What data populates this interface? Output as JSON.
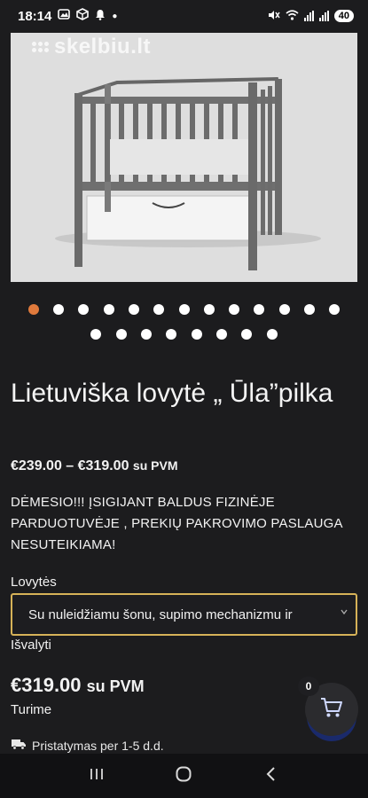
{
  "status_bar": {
    "time": "18:14",
    "battery": "40"
  },
  "gallery": {
    "watermark": "skelbiu.lt",
    "dots_row1": 13,
    "dots_row2": 8,
    "active_index": 0
  },
  "product": {
    "title": "Lietuviška lovytė „ Ūla”pilka",
    "price_range": "€239.00 – €319.00",
    "price_range_suffix": "su PVM",
    "notice": "DĖMESIO!!! ĮSIGIJANT BALDUS FIZINĖJE PARDUOTUVĖJE , PREKIŲ PAKROVIMO PASLAUGA NESUTEIKIAMA!",
    "option_label": "Lovytės",
    "option_selected": "Su nuleidžiamu šonu, supimo mechanizmu ir",
    "clear_label": "Išvalyti",
    "price": "€319.00",
    "price_suffix": "su PVM",
    "stock": "Turime",
    "delivery": "Pristatymas per 1-5 d.d."
  },
  "cart": {
    "count": "0"
  },
  "colors": {
    "accent": "#e07a3c",
    "select_border": "#d6b258",
    "background": "#1c1c1e"
  }
}
